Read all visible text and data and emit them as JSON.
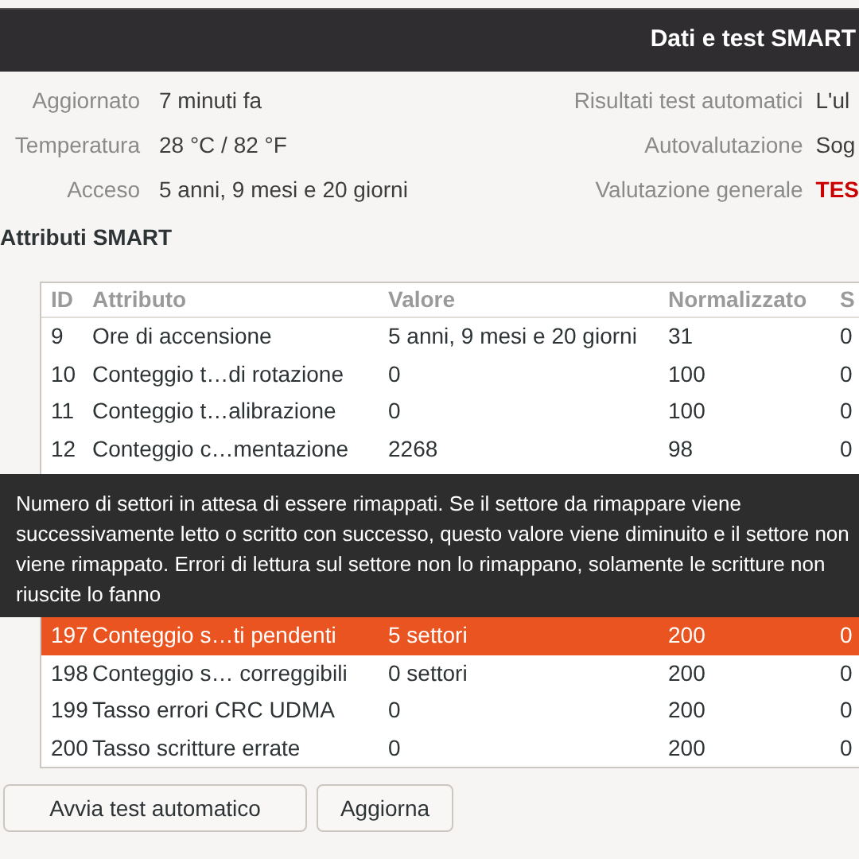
{
  "window": {
    "title": "Dati e test SMART"
  },
  "info_left": [
    {
      "label": "Aggiornato",
      "value": "7 minuti fa"
    },
    {
      "label": "Temperatura",
      "value": "28 °C / 82 °F"
    },
    {
      "label": "Acceso",
      "value": "5 anni, 9 mesi e 20 giorni"
    }
  ],
  "info_right": [
    {
      "label": "Risultati test automatici",
      "value": "L'ul",
      "kind": "normal"
    },
    {
      "label": "Autovalutazione",
      "value": "Sog",
      "kind": "normal"
    },
    {
      "label": "Valutazione generale",
      "value": "TES",
      "kind": "alert"
    }
  ],
  "section_title": "Attributi SMART",
  "table": {
    "columns": [
      "ID",
      "Attributo",
      "Valore",
      "Normalizzato",
      "S"
    ],
    "rows": [
      {
        "cells": [
          "9",
          "Ore di accensione",
          "5 anni, 9 mesi e 20 giorni",
          "31",
          "0"
        ],
        "selected": false
      },
      {
        "cells": [
          "10",
          "Conteggio t…di rotazione",
          "0",
          "100",
          "0"
        ],
        "selected": false
      },
      {
        "cells": [
          "11",
          "Conteggio t…alibrazione",
          "0",
          "100",
          "0"
        ],
        "selected": false
      },
      {
        "cells": [
          "12",
          "Conteggio c…mentazione",
          "2268",
          "98",
          "0"
        ],
        "selected": false
      },
      {
        "kind": "hidden"
      },
      {
        "cells": [
          "197",
          "Conteggio s…ti pendenti",
          "5 settori",
          "200",
          "0"
        ],
        "selected": true
      },
      {
        "cells": [
          "198",
          "Conteggio s… correggibili",
          "0 settori",
          "200",
          "0"
        ],
        "selected": false
      },
      {
        "cells": [
          "199",
          "Tasso errori CRC UDMA",
          "0",
          "200",
          "0"
        ],
        "selected": false
      },
      {
        "cells": [
          "200",
          "Tasso scritture errate",
          "0",
          "200",
          "0"
        ],
        "selected": false
      }
    ]
  },
  "tooltip": "Numero di settori in attesa di essere rimappati. Se il settore da rimappare viene successivamente letto o scritto con successo, questo valore viene diminuito e il settore non viene rimappato. Errori di lettura sul settore non lo rimappano, solamente le scritture non riuscite lo fanno",
  "buttons": [
    "Avvia test automatico",
    "Aggiorna"
  ]
}
